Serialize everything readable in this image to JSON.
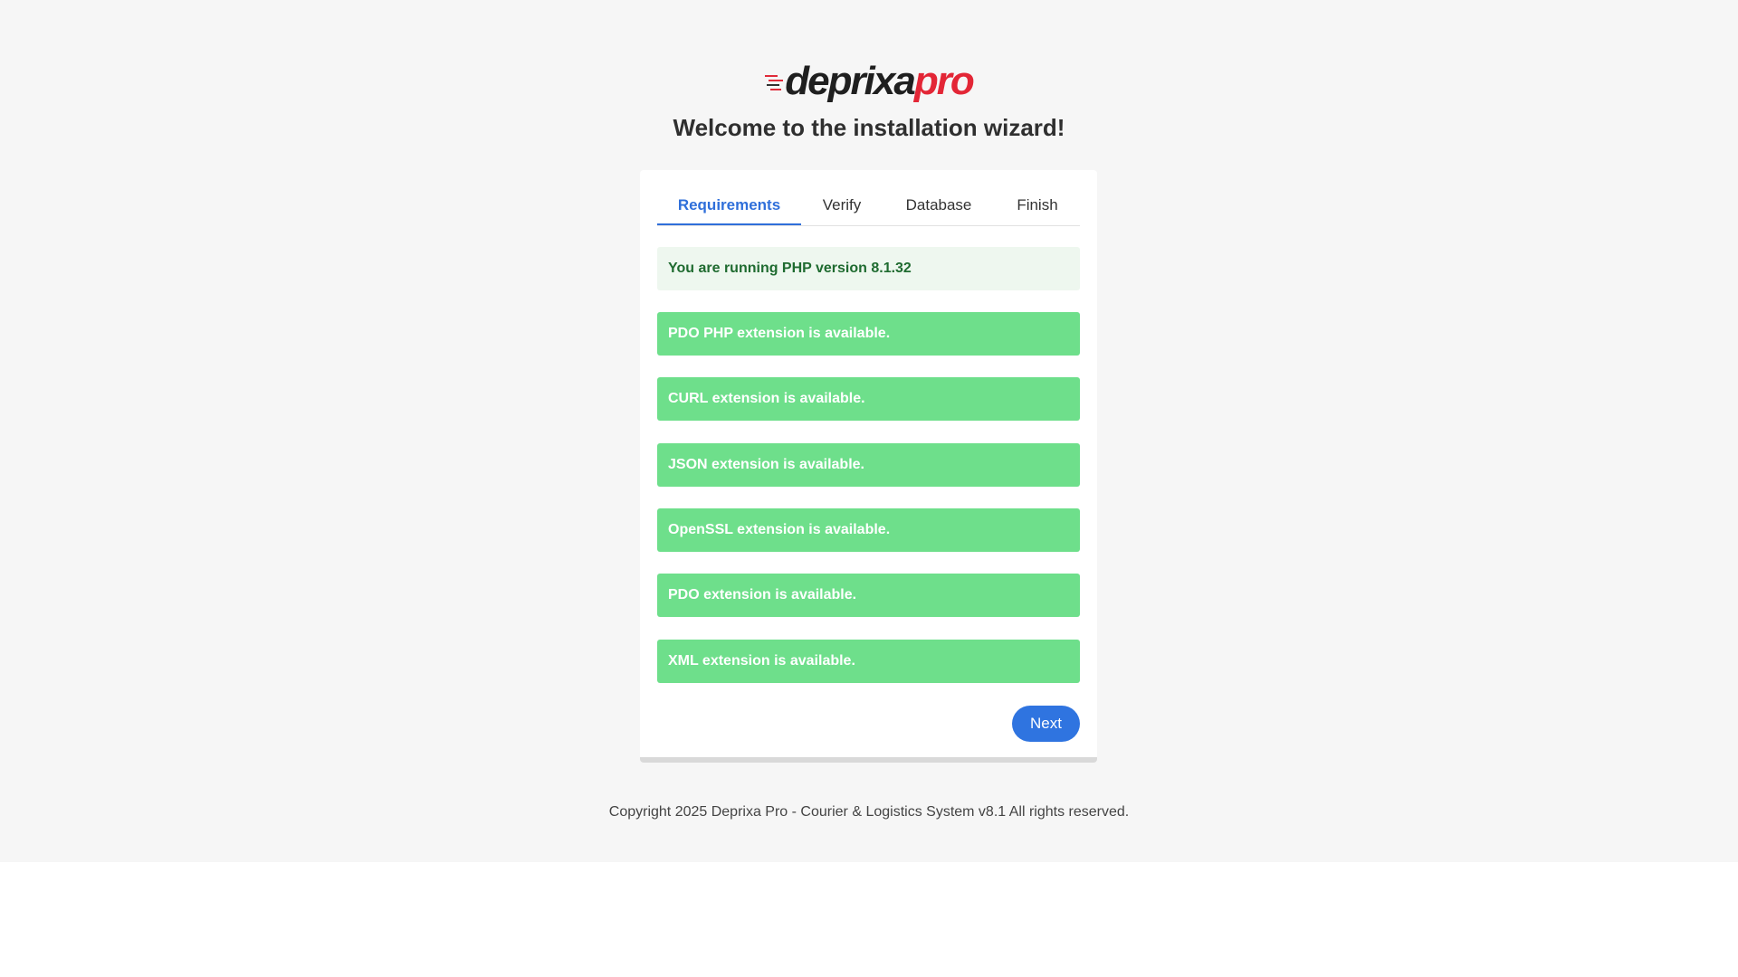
{
  "logo": {
    "part1": "deprixa",
    "part2": "pro"
  },
  "header": {
    "title": "Welcome to the installation wizard!"
  },
  "tabs": [
    {
      "label": "Requirements",
      "active": true
    },
    {
      "label": "Verify",
      "active": false
    },
    {
      "label": "Database",
      "active": false
    },
    {
      "label": "Finish",
      "active": false
    }
  ],
  "php_info": "You are running PHP version 8.1.32",
  "requirements": [
    "PDO PHP extension is available.",
    "CURL extension is available.",
    "JSON extension is available.",
    "OpenSSL extension is available.",
    "PDO extension is available.",
    "XML extension is available."
  ],
  "next_button": "Next",
  "footer": "Copyright 2025 Deprixa Pro - Courier & Logistics System v8.1 All rights reserved.",
  "colors": {
    "accent": "#2f74e0",
    "success_bg": "#6edf8b",
    "info_bg": "#eef7ef",
    "info_text": "#1f6b30",
    "logo_red": "#e32636"
  }
}
